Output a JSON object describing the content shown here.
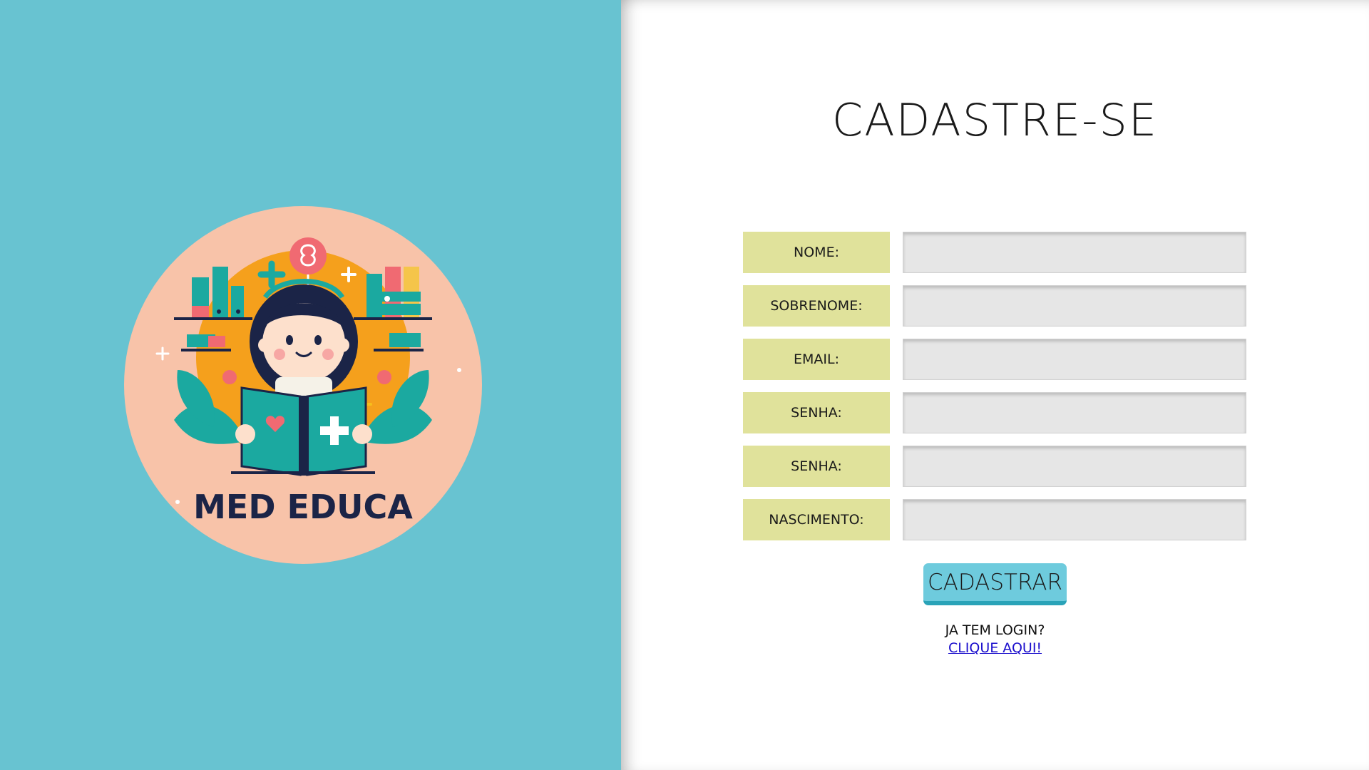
{
  "brand": {
    "logo_text": "MED EDUCA",
    "panel_color": "#68c3d1",
    "logo_circle_color": "#f8c3a9",
    "logo_inner_color": "#f5a01c",
    "accent_teal": "#1ba9a0",
    "accent_pink": "#f06a72",
    "text_navy": "#1b2447",
    "logo_highlight": "#f6be1c",
    "logo_icon": "girl-reading-medical-book-icon"
  },
  "form": {
    "title": "CADASTRE-SE",
    "fields": [
      {
        "label": "NOME:",
        "value": "",
        "placeholder": ""
      },
      {
        "label": "SOBRENOME:",
        "value": "",
        "placeholder": ""
      },
      {
        "label": "EMAIL:",
        "value": "",
        "placeholder": ""
      },
      {
        "label": "SENHA:",
        "value": "",
        "placeholder": ""
      },
      {
        "label": "SENHA:",
        "value": "",
        "placeholder": ""
      },
      {
        "label": "NASCIMENTO:",
        "value": "",
        "placeholder": ""
      }
    ],
    "label_color": "#e0e29b",
    "input_color": "#e6e6e6",
    "submit_label": "CADASTRAR",
    "submit_color": "#6ecbdd",
    "login_prompt": "JA TEM LOGIN?",
    "login_link": "CLIQUE AQUI!",
    "link_color": "#1a0dcc"
  }
}
